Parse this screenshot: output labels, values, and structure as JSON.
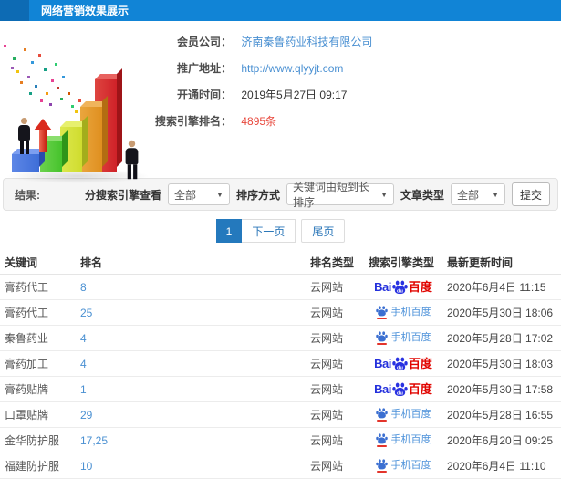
{
  "colors": {
    "header_blue": "#1184d6",
    "link_blue": "#4a90d2",
    "count_red": "#e8483d",
    "baidu_blue": "#2932e1",
    "baidu_red": "#e10602",
    "page_active_blue": "#2479bd"
  },
  "header": {
    "title": "网络营销效果展示"
  },
  "info": {
    "fields": [
      {
        "label": "会员公司：",
        "value": "济南秦鲁药业科技有限公司"
      },
      {
        "label": "推广地址：",
        "value": "http://www.qlyyjt.com"
      },
      {
        "label": "开通时间：",
        "value": "2019年5月27日 09:17"
      },
      {
        "label": "搜索引擎排名：",
        "value": "4895条"
      }
    ]
  },
  "filters": {
    "result_label": "结果:",
    "engine_view_label": "分搜索引擎查看",
    "engine_view_value": "全部",
    "sort_label": "排序方式",
    "sort_value": "关键词由短到长排序",
    "article_type_label": "文章类型",
    "article_type_value": "全部",
    "submit_label": "提交"
  },
  "pagination": {
    "current": "1",
    "next": "下一页",
    "last": "尾页"
  },
  "table": {
    "headers": [
      "关键词",
      "排名",
      "排名类型",
      "搜索引擎类型",
      "最新更新时间"
    ],
    "rows": [
      {
        "keyword": "膏药代工",
        "rank": "8",
        "rank_type": "云网站",
        "engine": "baidu",
        "time": "2020年6月4日 11:15"
      },
      {
        "keyword": "膏药代工",
        "rank": "25",
        "rank_type": "云网站",
        "engine": "baidu_mobile",
        "time": "2020年5月30日 18:06"
      },
      {
        "keyword": "秦鲁药业",
        "rank": "4",
        "rank_type": "云网站",
        "engine": "baidu_mobile",
        "time": "2020年5月28日 17:02"
      },
      {
        "keyword": "膏药加工",
        "rank": "4",
        "rank_type": "云网站",
        "engine": "baidu",
        "time": "2020年5月30日 18:03"
      },
      {
        "keyword": "膏药贴牌",
        "rank": "1",
        "rank_type": "云网站",
        "engine": "baidu",
        "time": "2020年5月30日 17:58"
      },
      {
        "keyword": "口罩贴牌",
        "rank": "29",
        "rank_type": "云网站",
        "engine": "baidu_mobile",
        "time": "2020年5月28日 16:55"
      },
      {
        "keyword": "金华防护服",
        "rank": "17,25",
        "rank_type": "云网站",
        "engine": "baidu_mobile",
        "time": "2020年6月20日 09:25"
      },
      {
        "keyword": "福建防护服",
        "rank": "10",
        "rank_type": "云网站",
        "engine": "baidu_mobile",
        "time": "2020年6月4日 11:10"
      }
    ]
  },
  "engines": {
    "baidu": {
      "bai": "Bai",
      "du": "du",
      "cn": "百度"
    },
    "baidu_mobile": {
      "label": "手机百度"
    }
  }
}
